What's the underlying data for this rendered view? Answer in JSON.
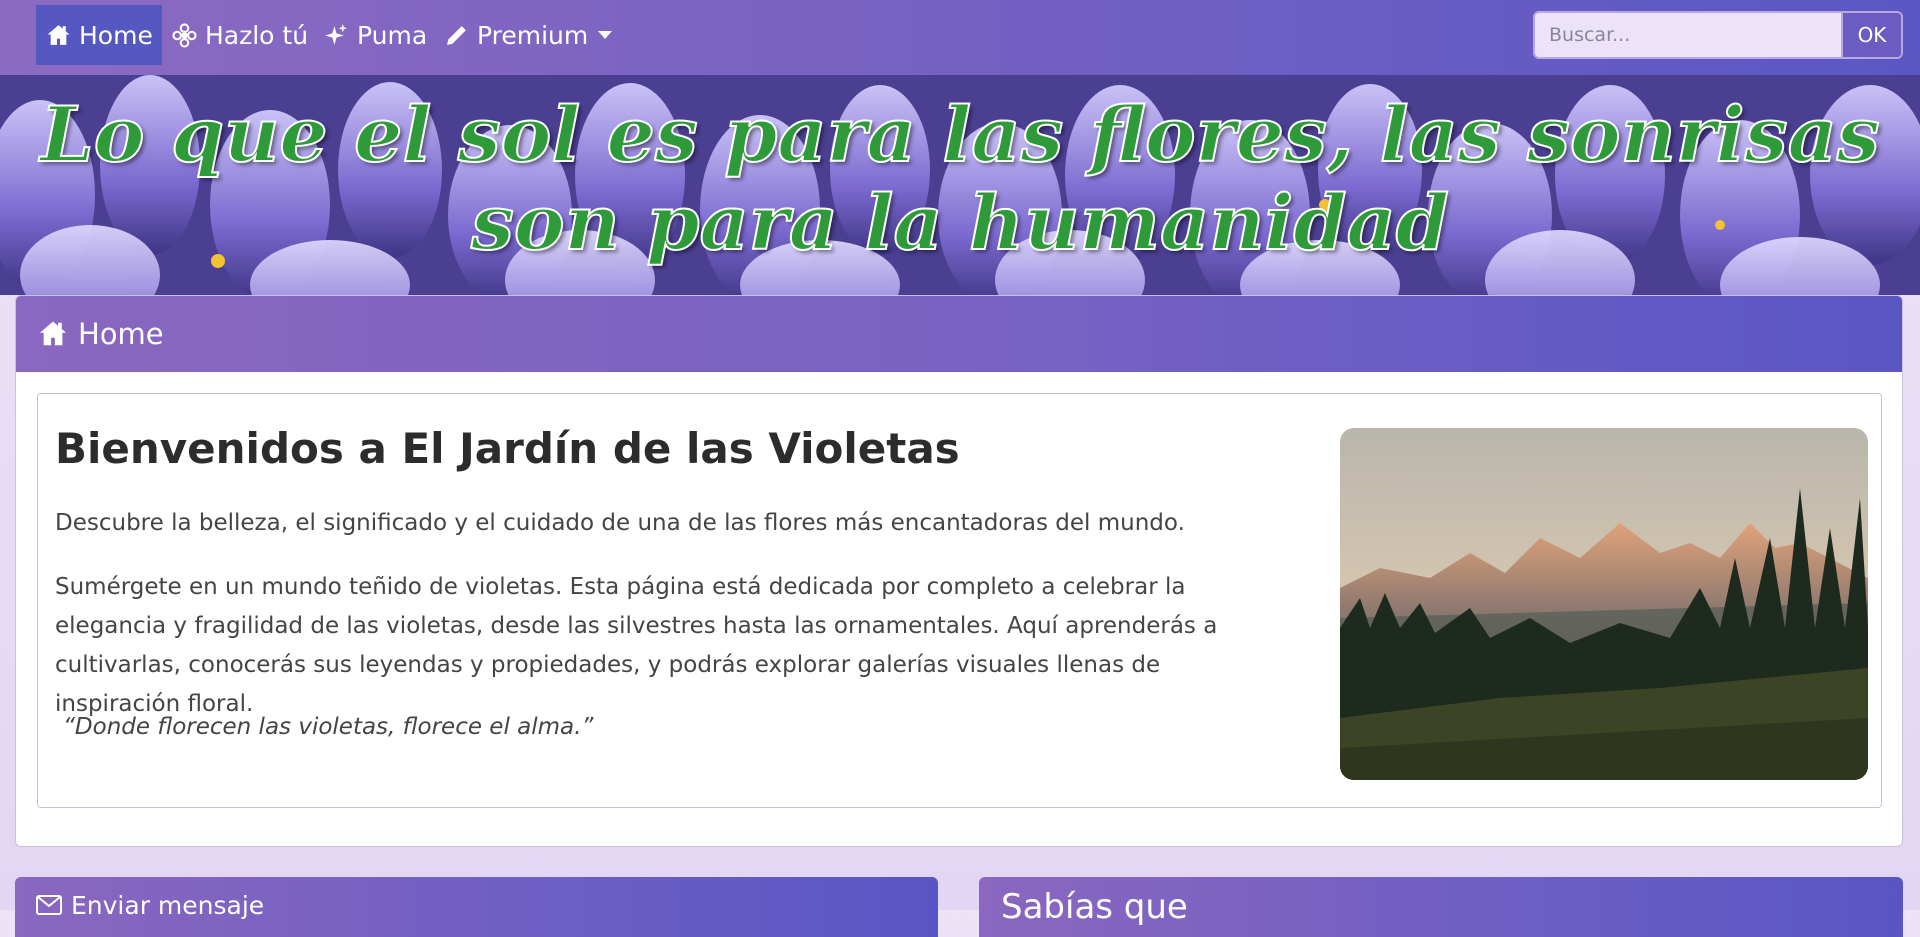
{
  "navbar": {
    "items": [
      {
        "label": "Home",
        "icon": "home-icon",
        "active": true
      },
      {
        "label": "Hazlo tú",
        "icon": "flower-icon",
        "active": false
      },
      {
        "label": "Puma",
        "icon": "sparkles-icon",
        "active": false
      },
      {
        "label": "Premium",
        "icon": "pen-icon",
        "active": false,
        "dropdown": true
      }
    ],
    "search": {
      "placeholder": "Buscar...",
      "value": "",
      "button_label": "OK"
    }
  },
  "banner": {
    "title": "Lo que el sol es para las flores, las sonrisas son para la humanidad"
  },
  "card": {
    "header_title": "Home",
    "welcome_title": "Bienvenidos a El Jardín de las Violetas",
    "subtitle": "Descubre la belleza, el significado y el cuidado de una de las flores más encantadoras del mundo.",
    "paragraph": "Sumérgete en un mundo teñido de violetas. Esta página está dedicada por completo a celebrar la elegancia y fragilidad de las violetas, desde las silvestres hasta las ornamentales. Aquí aprenderás a cultivarlas, conocerás sus leyendas y propiedades, y podrás explorar galerías visuales llenas de inspiración floral.",
    "quote": "“Donde florecen las violetas, florece el alma.”"
  },
  "panels": {
    "left_title": "Enviar mensaje",
    "right_title": "Sabías que"
  },
  "colors": {
    "nav_gradient_start": "#8c6bc2",
    "nav_gradient_end": "#5a57c4",
    "active_nav": "#5458c0",
    "banner_text": "#2f9a3a"
  }
}
